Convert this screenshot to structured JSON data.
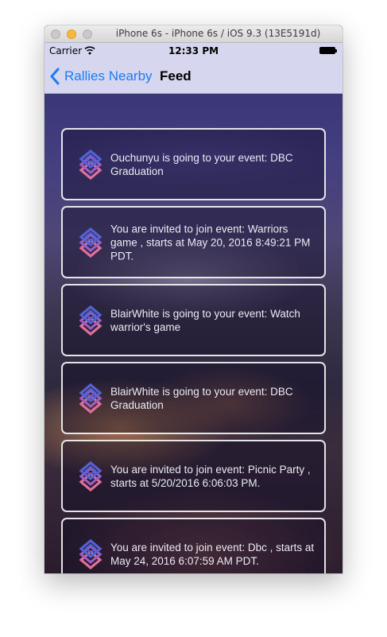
{
  "window": {
    "title": "iPhone 6s - iPhone 6s / iOS 9.3 (13E5191d)"
  },
  "status_bar": {
    "carrier": "Carrier",
    "time": "12:33 PM"
  },
  "nav": {
    "back_label": "Rallies Nearby",
    "title": "Feed"
  },
  "feed": {
    "items": [
      {
        "text": "Ouchunyu is going to your event: DBC Graduation"
      },
      {
        "text": "You are invited to join event: Warriors game , starts at May 20, 2016 8:49:21 PM PDT."
      },
      {
        "text": "BlairWhite is going to your event: Watch warrior's game"
      },
      {
        "text": "BlairWhite is going to your event: DBC Graduation"
      },
      {
        "text": "You are invited to join event: Picnic Party , starts at 5/20/2016 6:06:03 PM."
      },
      {
        "text": "You are invited to join event: Dbc , starts at May 24, 2016 6:07:59 AM PDT."
      }
    ]
  },
  "icons": {
    "feed_item": "rally-logo-icon",
    "back": "chevron-left-icon",
    "wifi": "wifi-icon",
    "battery": "battery-icon"
  },
  "colors": {
    "nav_background": "#d6d6ef",
    "accent": "#1a7cf6",
    "card_border": "#ffffff"
  }
}
